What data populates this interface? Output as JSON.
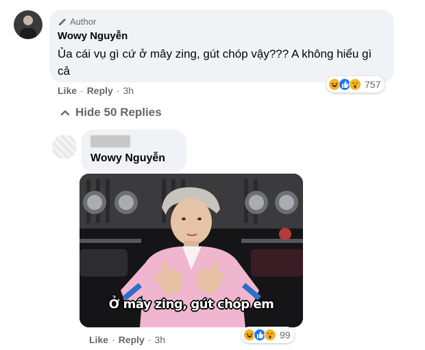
{
  "comment": {
    "author_badge": "Author",
    "author_name": "Wowy Nguyễn",
    "text": "Ủa cái vụ gì cứ ở mây zing, gút chóp vậy??? A không hiểu gì cả",
    "actions": {
      "like": "Like",
      "reply": "Reply",
      "time": "3h"
    },
    "reactions": {
      "icons": [
        "haha-icon",
        "like-icon",
        "wow-icon"
      ],
      "count": "757"
    }
  },
  "replies_toggle": {
    "label": "Hide 50 Replies",
    "icon": "chevron-up-icon"
  },
  "reply": {
    "author_name_blurred": true,
    "mention": "Wowy Nguyễn",
    "image_caption": "Ở mây zing, gút chóp em",
    "actions": {
      "like": "Like",
      "reply": "Reply",
      "time": "3h"
    },
    "reactions": {
      "icons": [
        "haha-icon",
        "like-icon",
        "wow-icon"
      ],
      "count": "99"
    }
  },
  "colors": {
    "bubble": "#f0f2f5",
    "secondary_text": "#65676b",
    "like_blue": "#1877f2",
    "haha_yellow": "#f7b125"
  }
}
